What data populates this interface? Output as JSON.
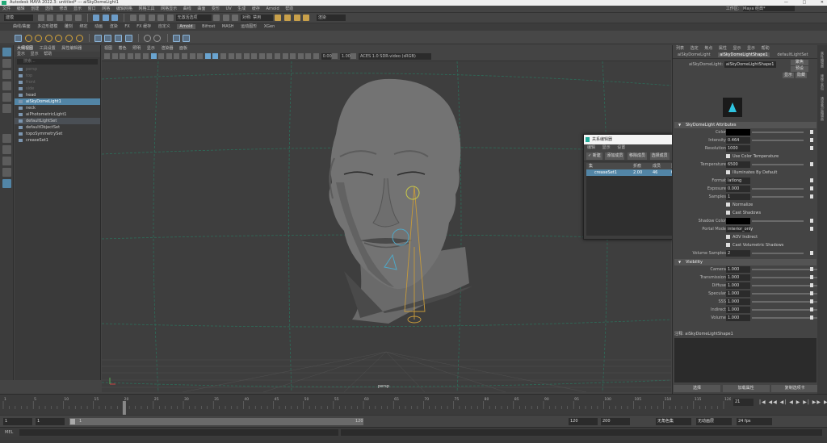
{
  "window": {
    "title": "Autodesk MAYA 2022.3: untitled* --- aiSkyDomeLight1",
    "controls": [
      "—",
      "□",
      "✕"
    ]
  },
  "menubar": {
    "items": [
      "文件",
      "编辑",
      "创建",
      "选择",
      "修改",
      "显示",
      "窗口",
      "网格",
      "编辑网格",
      "网格工具",
      "网格显示",
      "曲线",
      "曲面",
      "变形",
      "UV",
      "生成",
      "缓存",
      "Arnold",
      "帮助"
    ],
    "workspace_label": "工作区:",
    "workspace_value": "Maya 经典*"
  },
  "statusline": {
    "mode": "建模",
    "sym_label": "无激活选项",
    "target_label": "对称: 禁用",
    "render_value": "渲染"
  },
  "shelf": {
    "tabs": [
      "曲线/曲面",
      "多边形建模",
      "雕刻",
      "绑定",
      "动画",
      "渲染",
      "FX",
      "FX 缓存",
      "自定义",
      "Arnold",
      "Bifrost",
      "MASH",
      "运动图形",
      "XGen"
    ],
    "active_tab": "Arnold"
  },
  "outliner": {
    "tabs": [
      "大纲视图",
      "工具设置",
      "属性编辑器"
    ],
    "menu": [
      "显示",
      "显示",
      "帮助"
    ],
    "search_placeholder": "搜索...",
    "rows": [
      {
        "label": "persp",
        "state": "dim"
      },
      {
        "label": "top",
        "state": "dim"
      },
      {
        "label": "front",
        "state": "dim"
      },
      {
        "label": "side",
        "state": "dim"
      },
      {
        "label": "head",
        "state": "normal"
      },
      {
        "label": "aiSkyDomeLight1",
        "state": "selected"
      },
      {
        "label": "neck",
        "state": "normal"
      },
      {
        "label": "aiPhotometricLight1",
        "state": "normal"
      },
      {
        "label": "defaultLightSet",
        "state": "highlight"
      },
      {
        "label": "defaultObjectSet",
        "state": "normal"
      },
      {
        "label": "topoSymmetrySet",
        "state": "normal"
      },
      {
        "label": "creaseSet1",
        "state": "normal"
      }
    ]
  },
  "viewport": {
    "menu": [
      "视图",
      "着色",
      "照明",
      "显示",
      "渲染器",
      "面板"
    ],
    "exposure": "0.00",
    "gamma": "1.00",
    "color_space": "ACES 1.0 SDR-video (sRGB)",
    "camera_label": "persp"
  },
  "node_editor": {
    "title": "关系编辑器",
    "menu": [
      "编辑",
      "显示",
      "设置"
    ],
    "buttons": [
      "✓ 新建",
      "添加成员",
      "移除成员",
      "选择成员",
      "删除"
    ],
    "columns": [
      "集",
      "折痕",
      "成员",
      "选定"
    ],
    "rows": [
      {
        "name": "creaseSet1",
        "crease": "2.00",
        "members": "46",
        "selected": "0"
      }
    ]
  },
  "attribute_editor": {
    "menu": [
      "列表",
      "选定",
      "焦点",
      "属性",
      "显示",
      "显示",
      "帮助"
    ],
    "tabs": [
      "aiSkyDomeLight",
      "aiSkyDomeLightShape1",
      "defaultLightSet"
    ],
    "active_tab": "aiSkyDomeLightShape1",
    "node_label": "aiSkyDomeLight:",
    "node_value": "aiSkyDomeLightShape1",
    "buttons": [
      "聚焦",
      "预设",
      "显示",
      "隐藏"
    ],
    "section_sky": "SkyDomeLight Attributes",
    "sky_rows": [
      {
        "label": "Color",
        "kind": "color"
      },
      {
        "label": "Intensity",
        "kind": "slider",
        "value": "0.464"
      },
      {
        "label": "Resolution",
        "kind": "value",
        "value": "1000"
      },
      {
        "label": "",
        "kind": "check",
        "text": "Use Color Temperature"
      },
      {
        "label": "Temperature",
        "kind": "slider",
        "value": "6500"
      },
      {
        "label": "",
        "kind": "check",
        "text": "Illuminates By Default"
      },
      {
        "label": "Format",
        "kind": "value",
        "value": "latlong"
      },
      {
        "label": "Exposure",
        "kind": "slider",
        "value": "0.000"
      },
      {
        "label": "Samples",
        "kind": "slider",
        "value": "1"
      },
      {
        "label": "",
        "kind": "check",
        "text": "Normalize"
      },
      {
        "label": "",
        "kind": "check",
        "text": "Cast Shadows"
      },
      {
        "label": "Shadow Color",
        "kind": "color"
      },
      {
        "label": "Portal Mode",
        "kind": "value",
        "value": "interior_only"
      },
      {
        "label": "",
        "kind": "check",
        "text": "AOV Indirect"
      },
      {
        "label": "",
        "kind": "check",
        "text": "Cast Volumetric Shadows"
      },
      {
        "label": "Volume Samples",
        "kind": "slider",
        "value": "2"
      }
    ],
    "section_vis": "Visibility",
    "vis_rows": [
      {
        "label": "Camera",
        "value": "1.000"
      },
      {
        "label": "Transmission",
        "value": "1.000"
      },
      {
        "label": "Diffuse",
        "value": "1.000"
      },
      {
        "label": "Specular",
        "value": "1.000"
      },
      {
        "label": "SSS",
        "value": "1.000"
      },
      {
        "label": "Indirect",
        "value": "1.000"
      },
      {
        "label": "Volume",
        "value": "1.000"
      }
    ],
    "notes_label": "注释: aiSkyDomeLightShape1",
    "bottom_buttons": [
      "选择",
      "加载属性",
      "复制选项卡"
    ]
  },
  "side_tabs": [
    "属性编辑器",
    "建模工具包",
    "通道盒/层编辑器"
  ],
  "timeline": {
    "ticks": [
      "1",
      "5",
      "10",
      "15",
      "20",
      "25",
      "30",
      "35",
      "40",
      "45",
      "50",
      "55",
      "60",
      "65",
      "70",
      "75",
      "80",
      "85",
      "90",
      "95",
      "100",
      "105",
      "110",
      "115",
      "120"
    ],
    "current_frame": "21",
    "playback": "|◀ ◀◀ ◀| ◀ ▶ ▶| ▶▶ ▶|"
  },
  "range": {
    "start": "1",
    "start2": "1",
    "handle": "1",
    "end_inner": "120",
    "end": "120",
    "end2": "200",
    "char_set": "无角色集",
    "anim_layer": "无动画层",
    "fps": "24 fps"
  },
  "cmdline": {
    "label": "MEL"
  }
}
